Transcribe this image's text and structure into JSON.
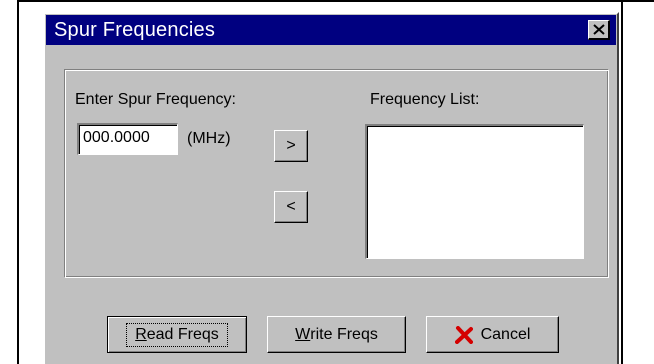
{
  "dialog": {
    "title": "Spur Frequencies",
    "close_icon": "close-x-icon"
  },
  "entry": {
    "label": "Enter Spur Frequency:",
    "value": "000.0000",
    "unit": "(MHz)"
  },
  "transfer": {
    "add_label": ">",
    "remove_label": "<"
  },
  "list": {
    "label": "Frequency List:",
    "items": []
  },
  "buttons": {
    "read_mnemonic": "R",
    "read_rest": "ead Freqs",
    "write_mnemonic": "W",
    "write_rest": "rite Freqs",
    "cancel_label": "Cancel",
    "cancel_icon": "red-x-icon"
  },
  "colors": {
    "titlebar": "#000080",
    "face": "#c0c0c0",
    "cancel_icon": "#d40000"
  }
}
